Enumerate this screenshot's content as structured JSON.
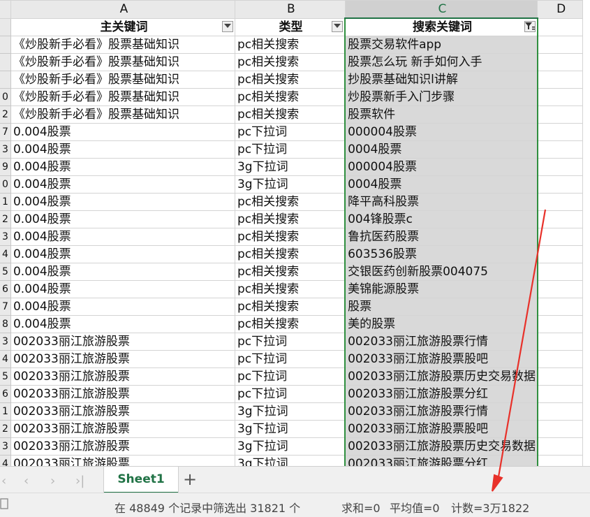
{
  "columns": [
    "A",
    "B",
    "C",
    "D"
  ],
  "header": {
    "a": "主关键词",
    "b": "类型",
    "c": "搜索关键词"
  },
  "rows": [
    {
      "num": "",
      "a": "《炒股新手必看》股票基础知识",
      "b": "pc相关搜索",
      "c": "股票交易软件app"
    },
    {
      "num": "",
      "a": "《炒股新手必看》股票基础知识",
      "b": "pc相关搜索",
      "c": "股票怎么玩 新手如何入手"
    },
    {
      "num": "",
      "a": "《炒股新手必看》股票基础知识",
      "b": "pc相关搜索",
      "c": "抄股票基础知识l讲解"
    },
    {
      "num": "0",
      "a": "《炒股新手必看》股票基础知识",
      "b": "pc相关搜索",
      "c": "炒股票新手入门步骤"
    },
    {
      "num": "2",
      "a": "《炒股新手必看》股票基础知识",
      "b": "pc相关搜索",
      "c": "股票软件"
    },
    {
      "num": "7",
      "a": "0.004股票",
      "b": "pc下拉词",
      "c": "000004股票"
    },
    {
      "num": "3",
      "a": "0.004股票",
      "b": "pc下拉词",
      "c": "0004股票"
    },
    {
      "num": "9",
      "a": "0.004股票",
      "b": "3g下拉词",
      "c": "000004股票"
    },
    {
      "num": "0",
      "a": "0.004股票",
      "b": "3g下拉词",
      "c": "0004股票"
    },
    {
      "num": "1",
      "a": "0.004股票",
      "b": "pc相关搜索",
      "c": "降平高科股票"
    },
    {
      "num": "2",
      "a": "0.004股票",
      "b": "pc相关搜索",
      "c": "004锋股票c"
    },
    {
      "num": "3",
      "a": "0.004股票",
      "b": "pc相关搜索",
      "c": "鲁抗医药股票"
    },
    {
      "num": "4",
      "a": "0.004股票",
      "b": "pc相关搜索",
      "c": "603536股票"
    },
    {
      "num": "5",
      "a": "0.004股票",
      "b": "pc相关搜索",
      "c": "交银医药创新股票004075"
    },
    {
      "num": "6",
      "a": "0.004股票",
      "b": "pc相关搜索",
      "c": "美锦能源股票"
    },
    {
      "num": "7",
      "a": "0.004股票",
      "b": "pc相关搜索",
      "c": "股票"
    },
    {
      "num": "8",
      "a": "0.004股票",
      "b": "pc相关搜索",
      "c": "美的股票"
    },
    {
      "num": "3",
      "a": "002033丽江旅游股票",
      "b": "pc下拉词",
      "c": "002033丽江旅游股票行情"
    },
    {
      "num": "4",
      "a": "002033丽江旅游股票",
      "b": "pc下拉词",
      "c": "002033丽江旅游股票股吧"
    },
    {
      "num": "5",
      "a": "002033丽江旅游股票",
      "b": "pc下拉词",
      "c": "002033丽江旅游股票历史交易数据"
    },
    {
      "num": "6",
      "a": "002033丽江旅游股票",
      "b": "pc下拉词",
      "c": "002033丽江旅游股票分红"
    },
    {
      "num": "1",
      "a": "002033丽江旅游股票",
      "b": "3g下拉词",
      "c": "002033丽江旅游股票行情"
    },
    {
      "num": "2",
      "a": "002033丽江旅游股票",
      "b": "3g下拉词",
      "c": "002033丽江旅游股票股吧"
    },
    {
      "num": "3",
      "a": "002033丽江旅游股票",
      "b": "3g下拉词",
      "c": "002033丽江旅游股票历史交易数据"
    },
    {
      "num": "4",
      "a": "002033丽江旅游股票",
      "b": "3g下拉词",
      "c": "002033丽江旅游股票分红"
    }
  ],
  "sheet_tab": "Sheet1",
  "add_sheet": "+",
  "status": {
    "filter_text": "在 48849 个记录中筛选出 31821 个",
    "sum": "求和=0",
    "average": "平均值=0",
    "count": "计数=3万1822"
  },
  "colors": {
    "accent": "#217346",
    "annotation_arrow": "#e8312a"
  }
}
